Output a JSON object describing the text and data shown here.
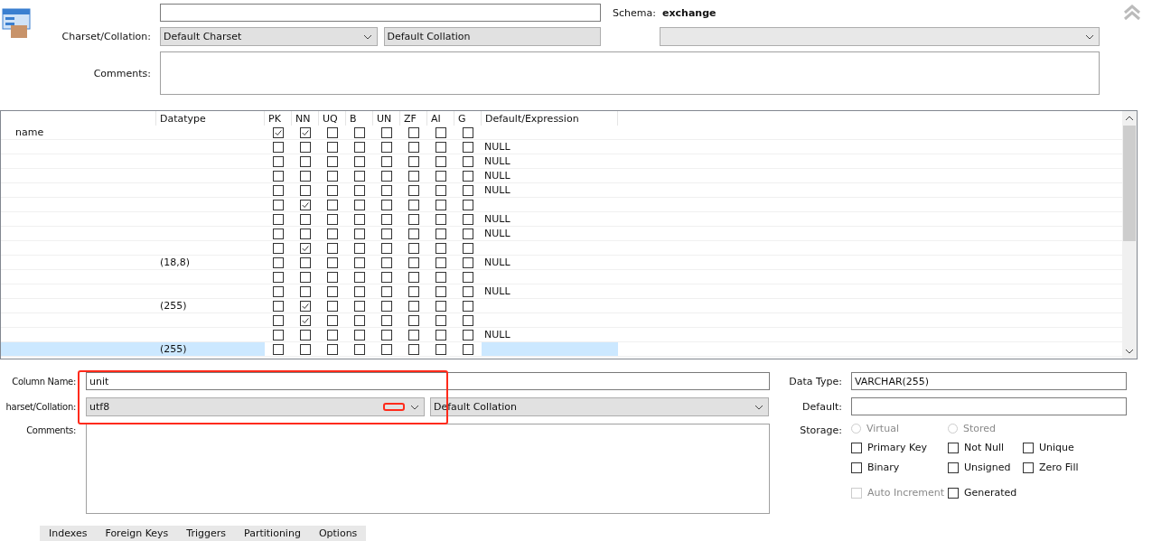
{
  "schema": {
    "label": "Schema:",
    "value": "exchange"
  },
  "table_charset": {
    "label": "Charset/Collation:",
    "charset": "Default Charset",
    "collation": "Default Collation"
  },
  "table_comments": {
    "label": "Comments:"
  },
  "grid": {
    "columns": [
      "Datatype",
      "PK",
      "NN",
      "UQ",
      "B",
      "UN",
      "ZF",
      "AI",
      "G",
      "Default/Expression"
    ],
    "rows": [
      {
        "name": "name",
        "checks": [
          true,
          true,
          false,
          false,
          false,
          false,
          false,
          false
        ],
        "selected": false
      },
      {
        "checks": [
          false,
          false,
          false,
          false,
          false,
          false,
          false,
          false
        ],
        "default": "NULL",
        "selected": false
      },
      {
        "checks": [
          false,
          false,
          false,
          false,
          false,
          false,
          false,
          false
        ],
        "default": "NULL",
        "selected": false
      },
      {
        "checks": [
          false,
          false,
          false,
          false,
          false,
          false,
          false,
          false
        ],
        "default": "NULL",
        "selected": false
      },
      {
        "checks": [
          false,
          false,
          false,
          false,
          false,
          false,
          false,
          false
        ],
        "default": "NULL",
        "selected": false
      },
      {
        "checks": [
          false,
          true,
          false,
          false,
          false,
          false,
          false,
          false
        ],
        "selected": false
      },
      {
        "checks": [
          false,
          false,
          false,
          false,
          false,
          false,
          false,
          false
        ],
        "default": "NULL",
        "selected": false
      },
      {
        "checks": [
          false,
          false,
          false,
          false,
          false,
          false,
          false,
          false
        ],
        "default": "NULL",
        "selected": false
      },
      {
        "checks": [
          false,
          true,
          false,
          false,
          false,
          false,
          false,
          false
        ],
        "selected": false
      },
      {
        "datatype": "(18,8)",
        "checks": [
          false,
          false,
          false,
          false,
          false,
          false,
          false,
          false
        ],
        "default": "NULL",
        "selected": false
      },
      {
        "checks": [
          false,
          false,
          false,
          false,
          false,
          false,
          false,
          false
        ],
        "selected": false
      },
      {
        "checks": [
          false,
          false,
          false,
          false,
          false,
          false,
          false,
          false
        ],
        "default": "NULL",
        "selected": false
      },
      {
        "datatype": "(255)",
        "checks": [
          false,
          true,
          false,
          false,
          false,
          false,
          false,
          false
        ],
        "selected": false
      },
      {
        "checks": [
          false,
          true,
          false,
          false,
          false,
          false,
          false,
          false
        ],
        "selected": false
      },
      {
        "checks": [
          false,
          false,
          false,
          false,
          false,
          false,
          false,
          false
        ],
        "default": "NULL",
        "selected": false
      },
      {
        "datatype": "(255)",
        "checks": [
          false,
          false,
          false,
          false,
          false,
          false,
          false,
          false
        ],
        "selected": true
      }
    ]
  },
  "column_name": {
    "label": "Column Name:",
    "value": "unit"
  },
  "column_charset": {
    "label": "harset/Collation:",
    "charset": "utf8",
    "collation": "Default Collation"
  },
  "column_comments": {
    "label": "Comments:"
  },
  "data_type": {
    "label": "Data Type:",
    "value": "VARCHAR(255)"
  },
  "default": {
    "label": "Default:"
  },
  "storage": {
    "label": "Storage:",
    "options": [
      {
        "label": "Virtual",
        "selected": false,
        "disabled": true
      },
      {
        "label": "Stored",
        "selected": false,
        "disabled": true
      }
    ]
  },
  "flags": [
    {
      "label": "Primary Key",
      "checked": false,
      "disabled": false
    },
    {
      "label": "Not Null",
      "checked": false,
      "disabled": false
    },
    {
      "label": "Unique",
      "checked": false,
      "disabled": false
    },
    {
      "label": "Binary",
      "checked": false,
      "disabled": false
    },
    {
      "label": "Unsigned",
      "checked": false,
      "disabled": false
    },
    {
      "label": "Zero Fill",
      "checked": false,
      "disabled": false
    },
    {
      "label": "Auto Increment",
      "checked": false,
      "disabled": true
    },
    {
      "label": "Generated",
      "checked": false,
      "disabled": false
    }
  ],
  "tabs": [
    {
      "label": "Indexes",
      "selected": false
    },
    {
      "label": "Foreign Keys",
      "selected": false
    },
    {
      "label": "Triggers",
      "selected": false
    },
    {
      "label": "Partitioning",
      "selected": false
    },
    {
      "label": "Options",
      "selected": false
    }
  ]
}
